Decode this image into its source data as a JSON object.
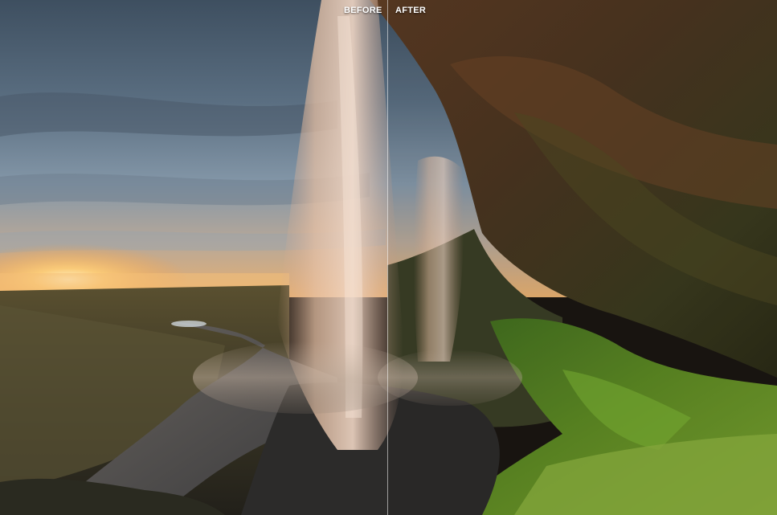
{
  "comparison": {
    "before_label": "BEFORE",
    "after_label": "AFTER",
    "split_position_percent": 49.9
  },
  "colors": {
    "divider": "#ffffff",
    "label_text": "#ffffff"
  }
}
